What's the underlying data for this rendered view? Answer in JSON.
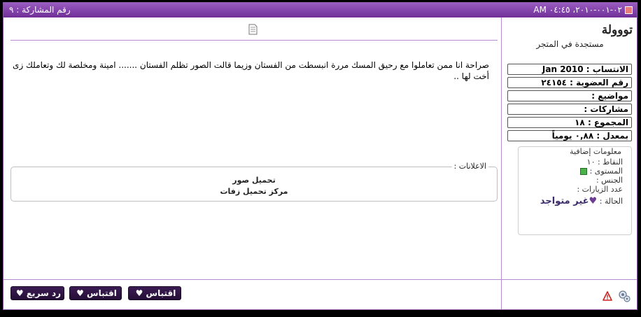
{
  "topbar": {
    "datetime": "٠٢-٠٠١-٢٠١٠، ٠٤:٤٥ AM",
    "post_number_label": "رقم المشاركة : ٩"
  },
  "user": {
    "name": "تووولة",
    "title": "مستجدة في المتجر",
    "stats": [
      {
        "label": "الانتساب : Jan 2010"
      },
      {
        "label": "رقم العضوية : ٢٤١٥٤"
      },
      {
        "label": "مواضيع :"
      },
      {
        "label": "مشاركات :"
      },
      {
        "label": "المجموع : ١٨"
      },
      {
        "label": "بمعدل : ٠,٨٨ يومياً"
      }
    ],
    "extra": {
      "title": "معلومات إضافية",
      "points": "النقاط : ١٠",
      "level": "المستوى :",
      "gender": "الجنس :",
      "visits": "عدد الزيارات :",
      "status_label": "الحالة :",
      "status_value": "غير متواجد"
    }
  },
  "message": {
    "body": "صراحة انا ممن تعاملوا مع رحيق المسك مررة انبسطت من الفستان وزيما قالت الصور تظلم الفستان ....... امينة ومخلصة لك وتعاملك زى أخت لها .."
  },
  "ads": {
    "legend": "الاعلانات :",
    "line1": "تحميل صور",
    "line2": "مركز تحميل زفات"
  },
  "buttons": {
    "quick_reply": "رد سريع",
    "quote1": "اقتباس",
    "quote2": "اقتباس"
  },
  "colors": {
    "header": "#7a3aa3",
    "button": "#2d1444",
    "divider": "#b78bcf"
  }
}
